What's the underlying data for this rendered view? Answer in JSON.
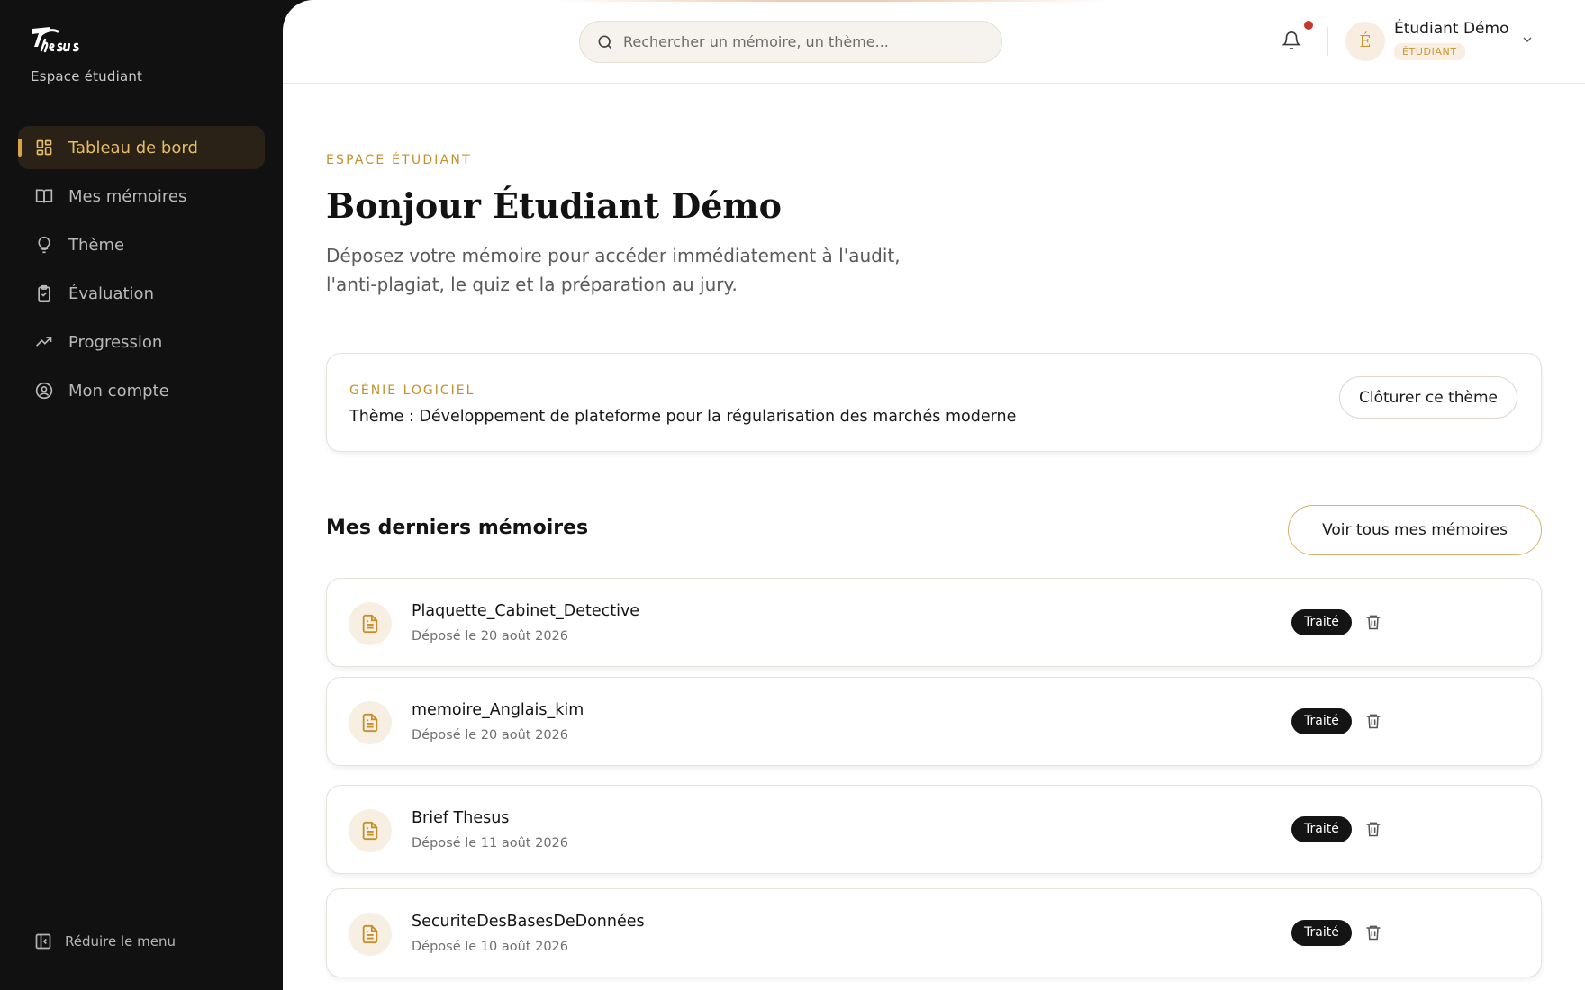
{
  "sidebar": {
    "space_label": "Espace étudiant",
    "items": [
      {
        "label": "Tableau de bord",
        "icon": "dashboard-icon",
        "active": true
      },
      {
        "label": "Mes mémoires",
        "icon": "book-icon",
        "active": false
      },
      {
        "label": "Thème",
        "icon": "lightbulb-icon",
        "active": false
      },
      {
        "label": "Évaluation",
        "icon": "clipboard-check-icon",
        "active": false
      },
      {
        "label": "Progression",
        "icon": "trending-up-icon",
        "active": false
      },
      {
        "label": "Mon compte",
        "icon": "user-circle-icon",
        "active": false
      }
    ],
    "collapse_label": "Réduire le menu"
  },
  "header": {
    "search_placeholder": "Rechercher un mémoire, un thème...",
    "user_name": "Étudiant Démo",
    "user_role": "ÉTUDIANT",
    "avatar_initial": "É"
  },
  "main": {
    "eyebrow": "ESPACE ÉTUDIANT",
    "title": "Bonjour Étudiant Démo",
    "subtitle": "Déposez votre mémoire pour accéder immédiatement à l'audit, l'anti-plagiat, le quiz et la préparation au jury.",
    "theme": {
      "category": "GÉNIE LOGICIEL",
      "text": "Thème : Développement de plateforme pour la régularisation des marchés moderne",
      "close_label": "Clôturer ce thème"
    },
    "memoires": {
      "title": "Mes derniers mémoires",
      "view_all_label": "Voir tous mes mémoires",
      "items": [
        {
          "name": "Plaquette_Cabinet_Detective",
          "date": "Déposé le 20 août 2026",
          "status": "Traité"
        },
        {
          "name": "memoire_Anglais_kim",
          "date": "Déposé le 20 août 2026",
          "status": "Traité"
        },
        {
          "name": "Brief Thesus",
          "date": "Déposé le 11 août 2026",
          "status": "Traité"
        },
        {
          "name": "SecuriteDesBasesDeDonnées",
          "date": "Déposé le 10 août 2026",
          "status": "Traité"
        }
      ]
    }
  },
  "colors": {
    "accent": "#c4902c",
    "sidebar_bg": "#111111",
    "active_nav_bg": "#2a2216",
    "badge_bg": "#141414",
    "notification_dot": "#c0392b"
  }
}
